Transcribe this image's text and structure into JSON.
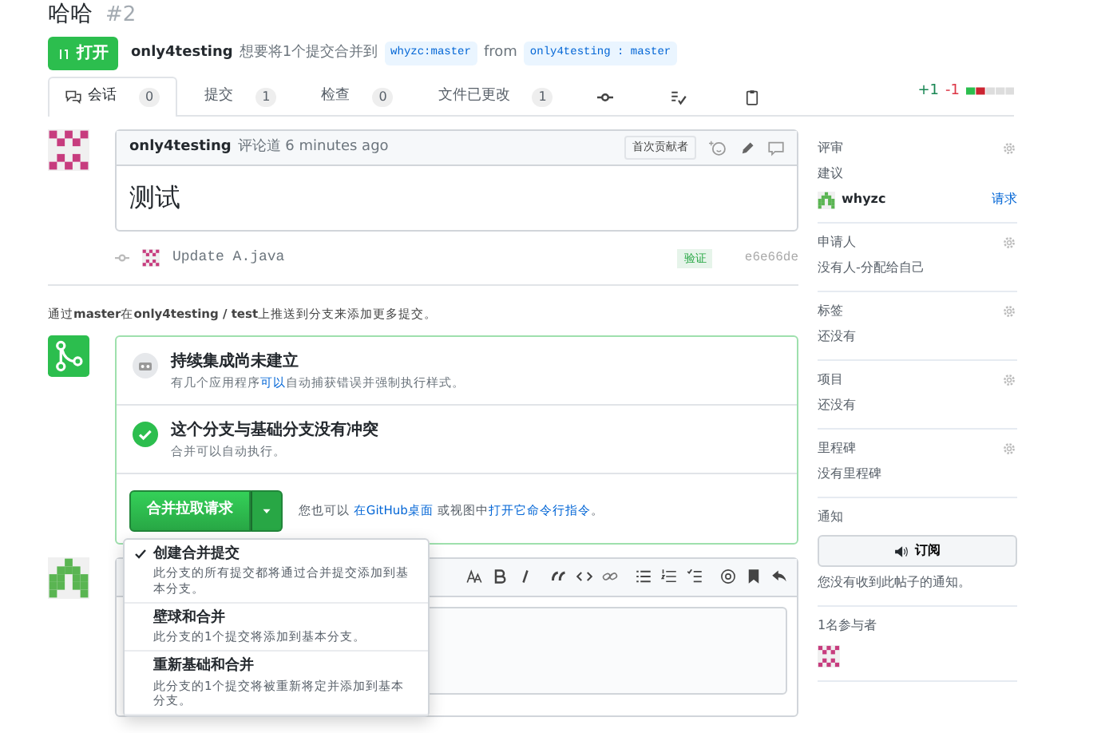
{
  "header": {
    "title": "哈哈",
    "number": "#2",
    "state": "打开",
    "author": "only4testing",
    "action": "想要将1个提交合并到",
    "base": "whyzc:master",
    "from": "from",
    "head": "only4testing : master"
  },
  "tabs": [
    {
      "kind": "text",
      "label": "会话",
      "count": "0",
      "selected": true
    },
    {
      "kind": "text",
      "label": "提交",
      "count": "1",
      "selected": false
    },
    {
      "kind": "text",
      "label": "检查",
      "count": "0",
      "selected": false
    },
    {
      "kind": "text",
      "label": "文件已更改",
      "count": "1",
      "selected": false
    },
    {
      "kind": "icon",
      "selected": false
    },
    {
      "kind": "icon",
      "selected": false
    },
    {
      "kind": "icon",
      "selected": false
    }
  ],
  "diffstat": {
    "added": "+1",
    "removed": "-1"
  },
  "comment": {
    "author": "only4testing",
    "action": "评论道 6 minutes ago",
    "badge": "首次贡献者",
    "body": "测试"
  },
  "commit": {
    "message": "Update A.java",
    "verified": "验证",
    "sha": "e6e66de"
  },
  "push_hint": "通过**master**在**only4testing / test**上推送到分支来添加更多提交。",
  "merge": {
    "checks": [
      {
        "kind": "ci",
        "title": "持续集成尚未建立",
        "before": "有几个应用程序",
        "link": "可以",
        "after": "自动捕获错误并强制执行样式。"
      },
      {
        "kind": "ok",
        "title": "这个分支与基础分支没有冲突",
        "before": "合并可以自动执行。"
      }
    ],
    "button": "合并拉取请求",
    "hint_before": "您也可以",
    "desktop_link": "在GitHub桌面",
    "hint_mid": "或视图中",
    "cli_link": "打开它命令行指令",
    "hint_end": "。",
    "menu": [
      {
        "title": "创建合并提交",
        "desc": "此分支的所有提交都将通过合并提交添加到基本分支。",
        "selected": true
      },
      {
        "title": "壁球和合并",
        "desc": "此分支的1个提交将添加到基本分支。",
        "selected": false
      },
      {
        "title": "重新基础和合并",
        "desc": "此分支的1个提交将被重新将定并添加到基本分支。",
        "selected": false
      }
    ]
  },
  "sidebar": {
    "sections": [
      {
        "title": "评审",
        "gear": true,
        "text": "建议",
        "reviewer": "whyzc",
        "request": "请求"
      },
      {
        "title": "申请人",
        "gear": true,
        "text": "没有人-分配给自己"
      },
      {
        "title": "标签",
        "gear": true,
        "text": "还没有"
      },
      {
        "title": "项目",
        "gear": true,
        "text": "还没有"
      },
      {
        "title": "里程碑",
        "gear": true,
        "text": "没有里程碑"
      },
      {
        "title": "通知",
        "gear": false,
        "button": "订阅",
        "text": "您没有收到此帖子的通知。"
      },
      {
        "title": "1名参与者",
        "gear": false,
        "kind": "participants"
      }
    ]
  }
}
